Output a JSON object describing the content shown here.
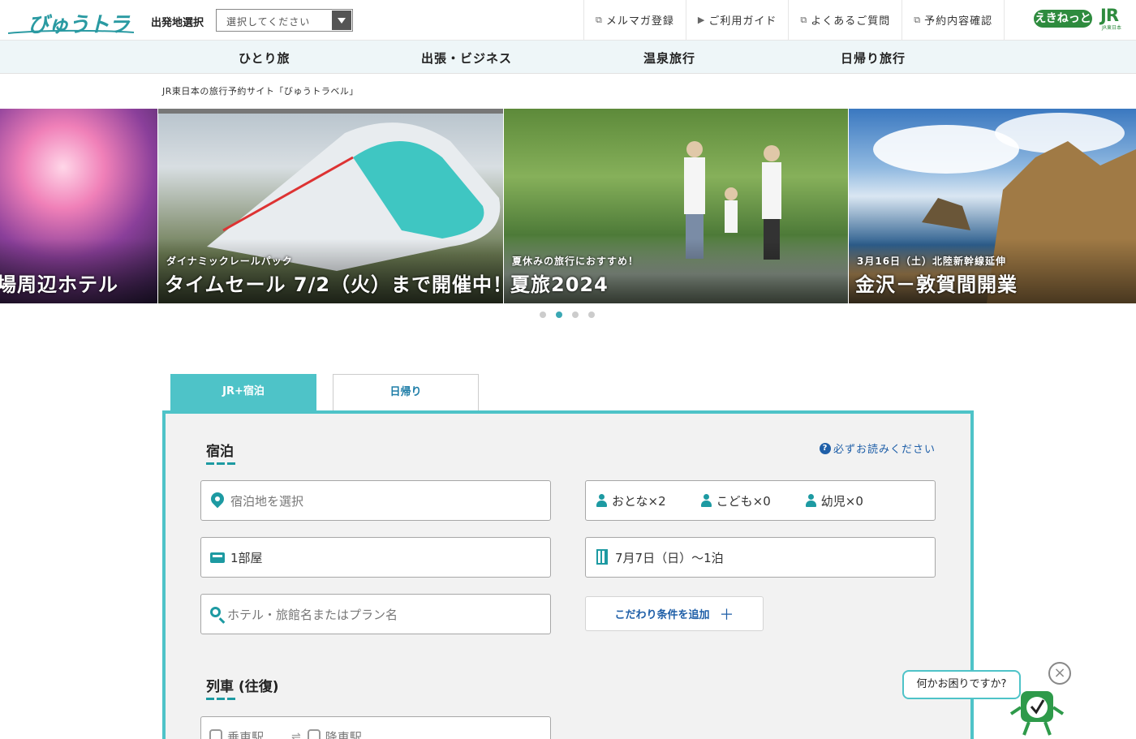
{
  "header": {
    "logo": "びゅうトラベル",
    "departure_label": "出発地選択",
    "departure_select": "選択してください",
    "links": [
      {
        "label": "メルマガ登録",
        "icon": "external-link-icon"
      },
      {
        "label": "ご利用ガイド",
        "icon": "triangle-right-icon"
      },
      {
        "label": "よくあるご質問",
        "icon": "external-link-icon"
      },
      {
        "label": "予約内容確認",
        "icon": "external-link-icon"
      }
    ],
    "brand_ekinet": "えきねっと",
    "brand_jr": "JR",
    "brand_jr_sub": "JR東日本"
  },
  "nav": {
    "items": [
      "ひとり旅",
      "出張・ビジネス",
      "温泉旅行",
      "日帰り旅行"
    ]
  },
  "tagline": "JR東日本の旅行予約サイト「びゅうトラベル」",
  "carousel": {
    "slides": [
      {
        "sub": "",
        "main": "場周辺ホテル"
      },
      {
        "sub": "ダイナミックレールパック",
        "main": "タイムセール 7/2（火）まで開催中！"
      },
      {
        "sub": "夏休みの旅行におすすめ！",
        "main": "夏旅2024"
      },
      {
        "sub": "3月16日（土）北陸新幹線延伸",
        "main": "金沢－敦賀間開業"
      }
    ],
    "active_index": 1
  },
  "tabs": [
    "JR+宿泊",
    "日帰り"
  ],
  "search": {
    "stay_title": "宿泊",
    "notice": "必ずお読みください",
    "destination_placeholder": "宿泊地を選択",
    "adults": "おとな×2",
    "children": "こども×0",
    "infants": "幼児×0",
    "rooms": "1部屋",
    "dates": "7月7日（日）～1泊",
    "keyword_placeholder": "ホテル・旅館名またはプラン名",
    "add_conditions": "こだわり条件を追加",
    "train_title": "列車 (往復)",
    "board_station": "乗車駅",
    "alight_station": "降車駅"
  },
  "help": {
    "bubble": "何かお困りですか?",
    "close": "×"
  },
  "colors": {
    "accent": "#4ec3c8",
    "icon": "#1d9aa2",
    "link": "#1f5fa8",
    "nav_bg": "#eef6f8",
    "panel_bg": "#f2f2f2",
    "brand_green": "#2e8b3e"
  }
}
